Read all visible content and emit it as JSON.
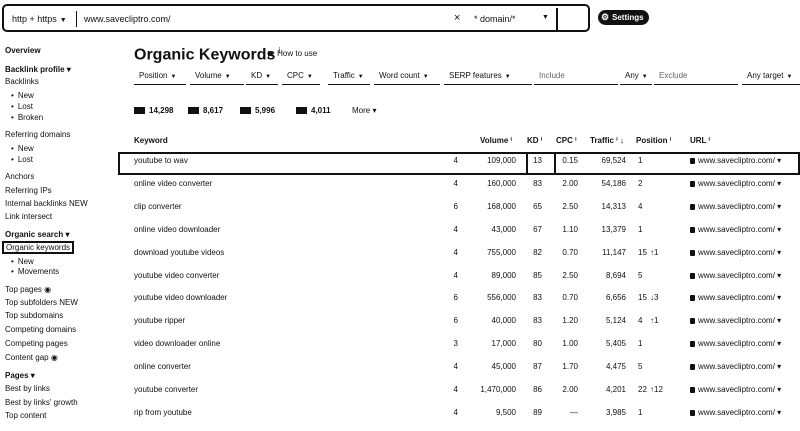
{
  "topbar": {
    "protocol": "http + https",
    "url": "www.savecliptro.com/",
    "clear_icon": "×",
    "mode": "* domain/*",
    "settings_label": "Settings"
  },
  "sidebar": {
    "overview": "Overview",
    "backlink_profile": "Backlink profile ▾",
    "backlinks": "Backlinks",
    "backlinks_new": "New",
    "backlinks_lost": "Lost",
    "backlinks_broken": "Broken",
    "referring_domains": "Referring domains",
    "rd_new": "New",
    "rd_lost": "Lost",
    "anchors": "Anchors",
    "referring_ips": "Referring IPs",
    "internal_backlinks": "Internal backlinks NEW",
    "link_intersect": "Link intersect",
    "organic_search": "Organic search ▾",
    "organic_keywords": "Organic keywords",
    "ok_new": "New",
    "ok_movements": "Movements",
    "top_pages": "Top pages ◉",
    "top_subfolders": "Top subfolders NEW",
    "top_subdomains": "Top subdomains",
    "competing_domains": "Competing domains",
    "competing_pages": "Competing pages",
    "content_gap": "Content gap ◉",
    "pages": "Pages ▾",
    "best_by_links": "Best by links",
    "best_by_links_growth": "Best by links' growth",
    "top_content": "Top content"
  },
  "page": {
    "title": "Organic Keywords",
    "title_mark": "i",
    "how_to_use": "How to use"
  },
  "filters": {
    "position": "Position",
    "volume": "Volume",
    "kd": "KD",
    "cpc": "CPC",
    "traffic": "Traffic",
    "word_count": "Word count",
    "serp_features": "SERP features",
    "include_placeholder": "Include",
    "include_mode": "Any",
    "exclude_placeholder": "Exclude",
    "target": "Any target"
  },
  "stats": [
    {
      "icon": "flag-us-icon",
      "value": "14,298"
    },
    {
      "icon": "flag-gb-icon",
      "value": "8,617"
    },
    {
      "icon": "flag-in-icon",
      "value": "5,996"
    },
    {
      "icon": "flag-de-icon",
      "value": "4,011"
    }
  ],
  "more_label": "More ▾",
  "table": {
    "headers": {
      "keyword": "Keyword",
      "volume": "Volume ⁱ",
      "kd": "KD ⁱ",
      "cpc": "CPC ⁱ",
      "traffic": "Traffic ⁱ ↓",
      "position": "Position ⁱ",
      "url": "URL ⁱ"
    },
    "rows": [
      {
        "keyword": "youtube to wav",
        "sf": "4",
        "volume": "109,000",
        "kd": "13",
        "cpc": "0.15",
        "traffic": "69,524",
        "position": "1",
        "change": "",
        "url": "www.savecliptro.com/ ▾"
      },
      {
        "keyword": "online video converter",
        "sf": "4",
        "volume": "160,000",
        "kd": "83",
        "cpc": "2.00",
        "traffic": "54,186",
        "position": "2",
        "change": "",
        "url": "www.savecliptro.com/ ▾"
      },
      {
        "keyword": "clip converter",
        "sf": "6",
        "volume": "168,000",
        "kd": "65",
        "cpc": "2.50",
        "traffic": "14,313",
        "position": "4",
        "change": "",
        "url": "www.savecliptro.com/ ▾"
      },
      {
        "keyword": "online video downloader",
        "sf": "4",
        "volume": "43,000",
        "kd": "67",
        "cpc": "1.10",
        "traffic": "13,379",
        "position": "1",
        "change": "",
        "url": "www.savecliptro.com/ ▾"
      },
      {
        "keyword": "download youtube videos",
        "sf": "4",
        "volume": "755,000",
        "kd": "82",
        "cpc": "0.70",
        "traffic": "11,147",
        "position": "15",
        "change": "↑1",
        "url": "www.savecliptro.com/ ▾"
      },
      {
        "keyword": "youtube video converter",
        "sf": "4",
        "volume": "89,000",
        "kd": "85",
        "cpc": "2.50",
        "traffic": "8,694",
        "position": "5",
        "change": "",
        "url": "www.savecliptro.com/ ▾"
      },
      {
        "keyword": "youtube video downloader",
        "sf": "6",
        "volume": "556,000",
        "kd": "83",
        "cpc": "0.70",
        "traffic": "6,656",
        "position": "15",
        "change": "↓3",
        "url": "www.savecliptro.com/ ▾"
      },
      {
        "keyword": "youtube ripper",
        "sf": "6",
        "volume": "40,000",
        "kd": "83",
        "cpc": "1.20",
        "traffic": "5,124",
        "position": "4",
        "change": "↑1",
        "url": "www.savecliptro.com/ ▾"
      },
      {
        "keyword": "video downloader online",
        "sf": "3",
        "volume": "17,000",
        "kd": "80",
        "cpc": "1.00",
        "traffic": "5,405",
        "position": "1",
        "change": "",
        "url": "www.savecliptro.com/ ▾"
      },
      {
        "keyword": "online converter",
        "sf": "4",
        "volume": "45,000",
        "kd": "87",
        "cpc": "1.70",
        "traffic": "4,475",
        "position": "5",
        "change": "",
        "url": "www.savecliptro.com/ ▾"
      },
      {
        "keyword": "youtube converter",
        "sf": "4",
        "volume": "1,470,000",
        "kd": "86",
        "cpc": "2.00",
        "traffic": "4,201",
        "position": "22",
        "change": "↑12",
        "url": "www.savecliptro.com/ ▾"
      },
      {
        "keyword": "rip from youtube",
        "sf": "4",
        "volume": "9,500",
        "kd": "89",
        "cpc": "—",
        "traffic": "3,985",
        "position": "1",
        "change": "",
        "url": "www.savecliptro.com/ ▾"
      }
    ]
  }
}
